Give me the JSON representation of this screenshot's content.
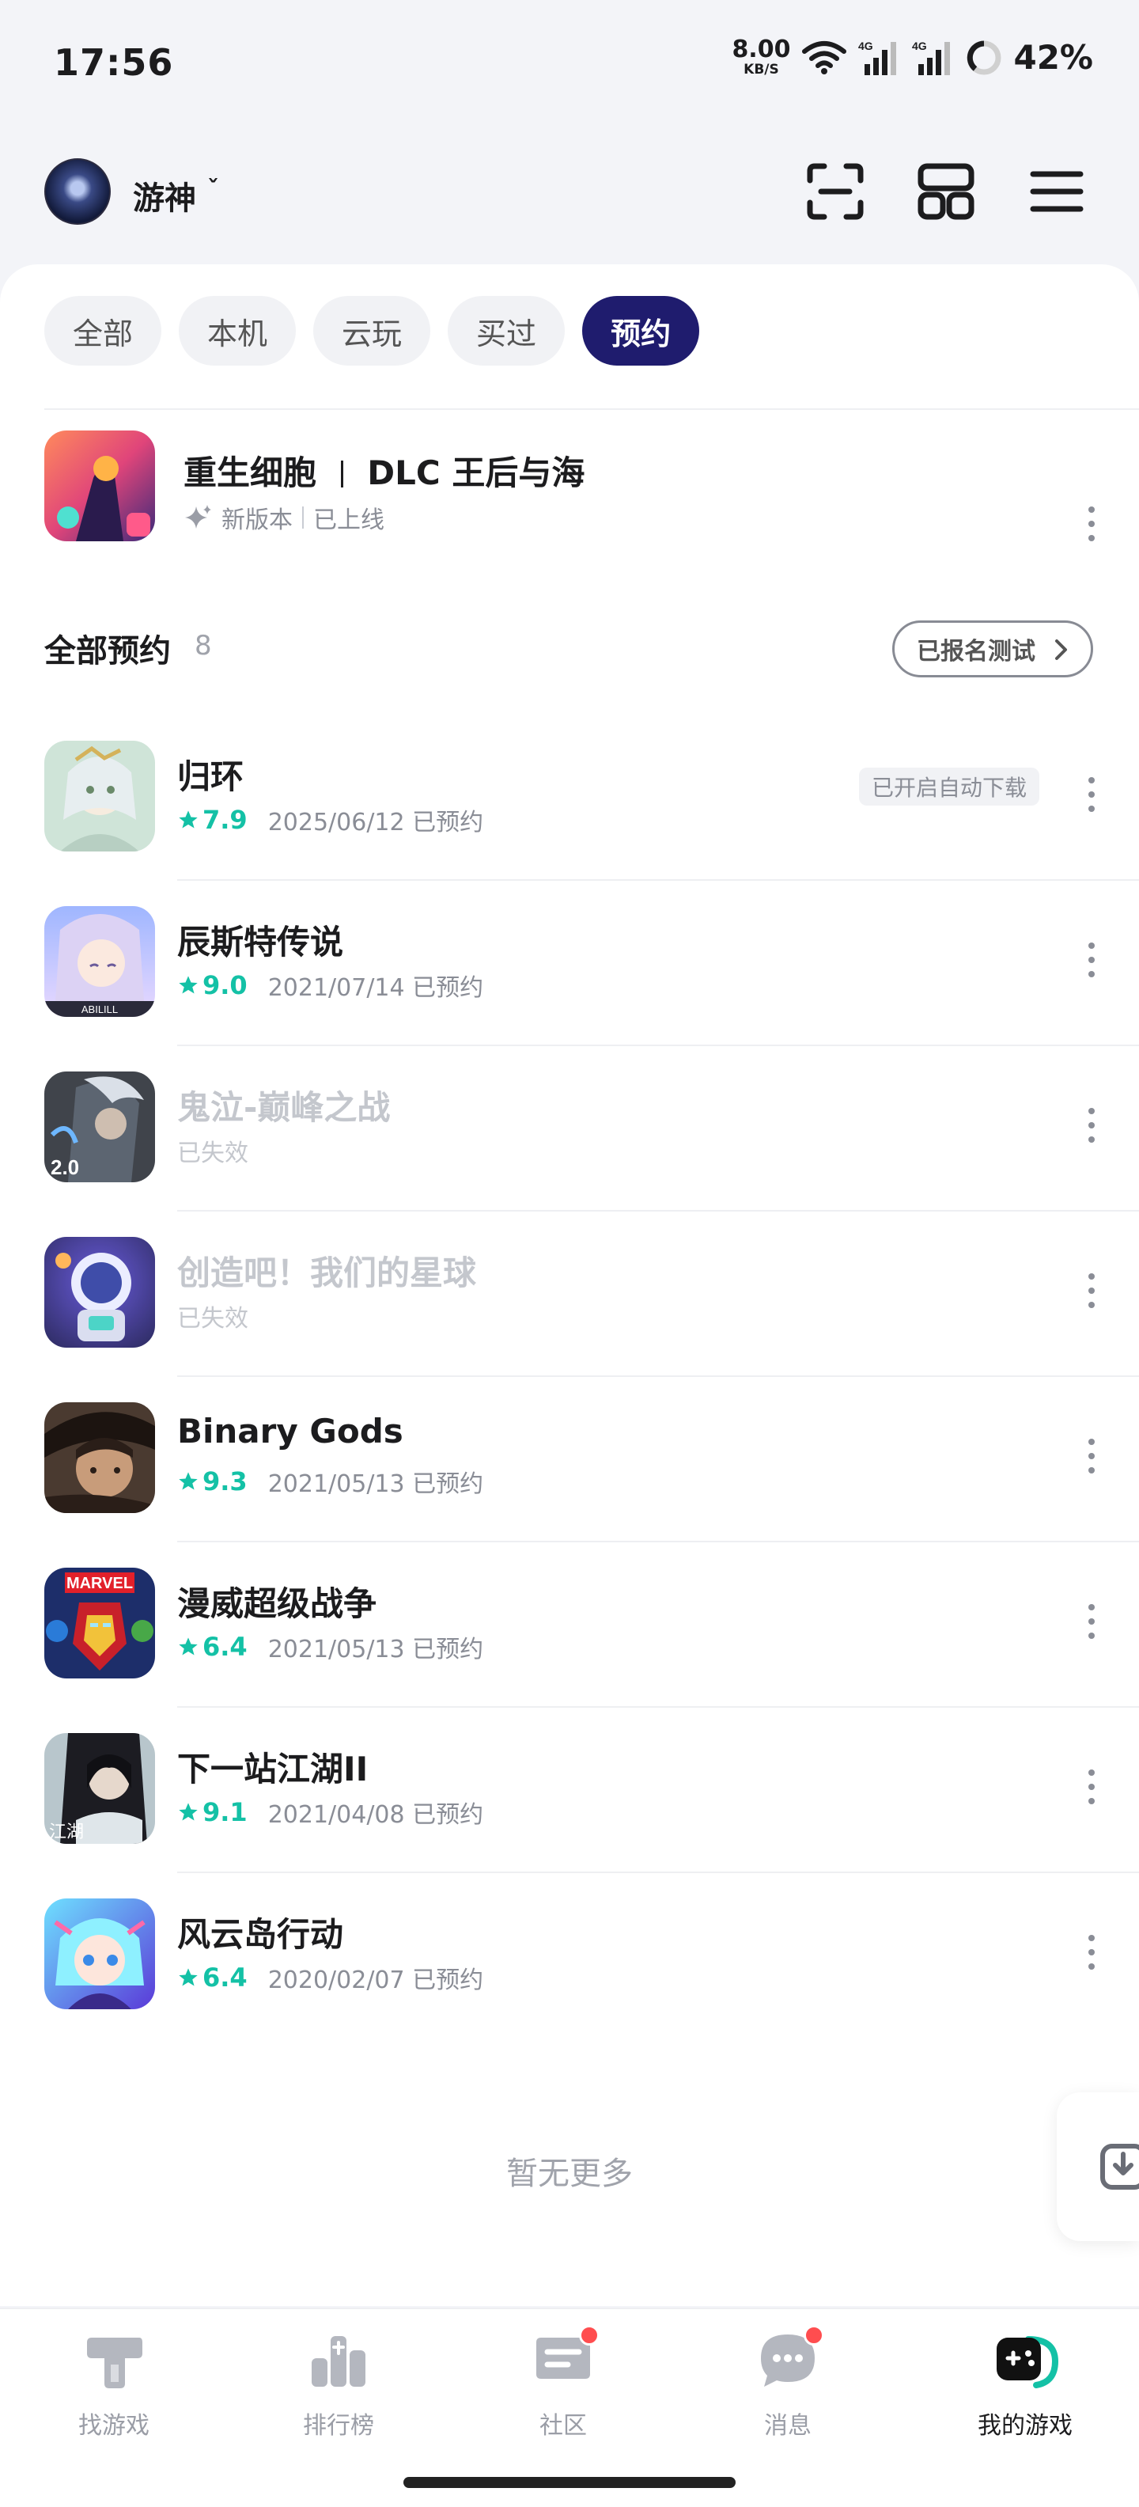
{
  "status_bar": {
    "time": "17:56",
    "net_speed_value": "8.00",
    "net_speed_unit": "KB/S",
    "battery": "42%",
    "icons": [
      "wifi-icon",
      "signal-4g-icon",
      "signal-4g-icon",
      "battery-ring-icon"
    ]
  },
  "header": {
    "username": "游神",
    "chevron": "ˇ",
    "icons": [
      "scan-icon",
      "apps-grid-icon",
      "menu-icon"
    ]
  },
  "filter_tabs": [
    {
      "label": "全部",
      "active": false
    },
    {
      "label": "本机",
      "active": false
    },
    {
      "label": "云玩",
      "active": false
    },
    {
      "label": "买过",
      "active": false
    },
    {
      "label": "预约",
      "active": true
    }
  ],
  "featured": {
    "title": "重生细胞",
    "title_suffix": "DLC 王后与海",
    "tag": "新版本",
    "status": "已上线"
  },
  "section": {
    "title": "全部预约",
    "count": "8",
    "test_button": "已报名测试"
  },
  "reservations": [
    {
      "title": "归环",
      "score": "7.9",
      "date_text": "2025/06/12 已预约",
      "auto_tag": "已开启自动下载",
      "inactive": false
    },
    {
      "title": "辰斯特传说",
      "score": "9.0",
      "date_text": "2021/07/14 已预约",
      "auto_tag": "",
      "inactive": false
    },
    {
      "title": "鬼泣-巅峰之战",
      "score": "",
      "date_text": "已失效",
      "auto_tag": "",
      "inactive": true
    },
    {
      "title": "创造吧！我们的星球",
      "score": "",
      "date_text": "已失效",
      "auto_tag": "",
      "inactive": true
    },
    {
      "title": "Binary Gods",
      "score": "9.3",
      "date_text": "2021/05/13 已预约",
      "auto_tag": "",
      "inactive": false
    },
    {
      "title": "漫威超级战争",
      "score": "6.4",
      "date_text": "2021/05/13 已预约",
      "auto_tag": "",
      "inactive": false
    },
    {
      "title": "下一站江湖II",
      "score": "9.1",
      "date_text": "2021/04/08 已预约",
      "auto_tag": "",
      "inactive": false
    },
    {
      "title": "风云岛行动",
      "score": "6.4",
      "date_text": "2020/02/07 已预约",
      "auto_tag": "",
      "inactive": false
    }
  ],
  "footer_text": "暂无更多",
  "bottom_nav": [
    {
      "label": "找游戏",
      "icon": "find-game-icon",
      "active": false,
      "badge": false
    },
    {
      "label": "排行榜",
      "icon": "ranking-icon",
      "active": false,
      "badge": false
    },
    {
      "label": "社区",
      "icon": "community-icon",
      "active": false,
      "badge": true
    },
    {
      "label": "消息",
      "icon": "message-icon",
      "active": false,
      "badge": true
    },
    {
      "label": "我的游戏",
      "icon": "my-games-icon",
      "active": true,
      "badge": false
    }
  ],
  "colors": {
    "accent": "#1f1c6e",
    "score": "#14c1a6",
    "badge": "#ff4d4f"
  }
}
